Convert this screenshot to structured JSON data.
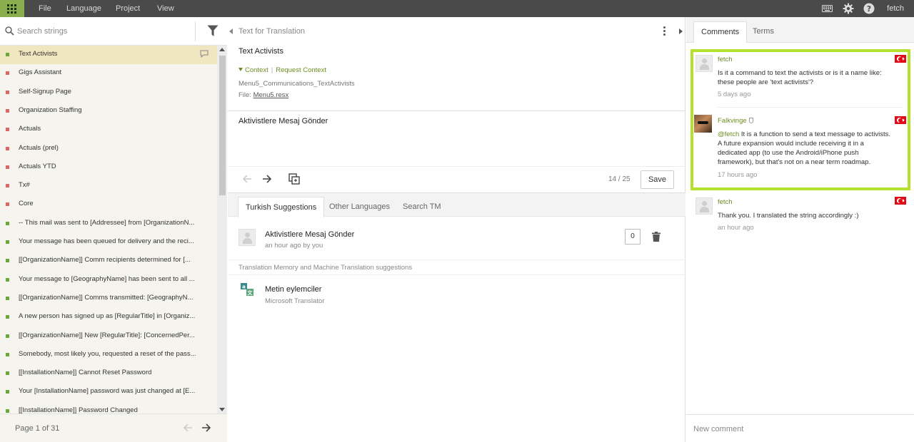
{
  "topbar": {
    "menu": [
      "File",
      "Language",
      "Project",
      "View"
    ],
    "username": "fetch",
    "icons": [
      "apps-grid-icon",
      "keyboard-icon",
      "gear-icon",
      "help-icon"
    ]
  },
  "left": {
    "search_placeholder": "Search strings",
    "strings": [
      {
        "text": "Text Activists",
        "status": "translated",
        "active": true,
        "has_comment": true
      },
      {
        "text": "Gigs Assistant",
        "status": "untranslated"
      },
      {
        "text": "Self-Signup Page",
        "status": "untranslated"
      },
      {
        "text": "Organization Staffing",
        "status": "untranslated"
      },
      {
        "text": "Actuals",
        "status": "untranslated"
      },
      {
        "text": "Actuals (prel)",
        "status": "untranslated"
      },
      {
        "text": "Actuals YTD",
        "status": "untranslated"
      },
      {
        "text": "Tx#",
        "status": "untranslated"
      },
      {
        "text": "Core",
        "status": "untranslated"
      },
      {
        "text": "-- This mail was sent to [Addressee] from [OrganizationN...",
        "status": "translated"
      },
      {
        "text": "Your message has been queued for delivery and the reci...",
        "status": "translated"
      },
      {
        "text": "[[OrganizationName]] Comm recipients determined for [...",
        "status": "translated"
      },
      {
        "text": "Your message to [GeographyName] has been sent to all ...",
        "status": "translated"
      },
      {
        "text": "[[OrganizationName]] Comms transmitted: [GeographyN...",
        "status": "translated"
      },
      {
        "text": "A new person has signed up as [RegularTitle] in [Organiz...",
        "status": "translated"
      },
      {
        "text": "[[OrganizationName]] New [RegularTitle]: [ConcernedPer...",
        "status": "translated"
      },
      {
        "text": "Somebody, most likely you, requested a reset of the pass...",
        "status": "translated"
      },
      {
        "text": "[[InstallationName]] Cannot Reset Password",
        "status": "translated"
      },
      {
        "text": "Your [InstallationName] password was just changed at [E...",
        "status": "translated"
      },
      {
        "text": "[[InstallationName]] Password Changed",
        "status": "translated"
      }
    ],
    "pager_label": "Page 1 of 31"
  },
  "middle": {
    "section_title": "Text for Translation",
    "source_text": "Text Activists",
    "context_label": "Context",
    "request_context_label": "Request Context",
    "string_key": "Menu5_Communications_TextActivists",
    "file_prefix": "File:",
    "file_name": "Menu5.resx",
    "translation_value": "Aktivistlere Mesaj Gönder",
    "counter": "14 / 25",
    "save_label": "Save",
    "tabs": [
      "Turkish Suggestions",
      "Other Languages",
      "Search TM"
    ],
    "suggestion": {
      "text": "Aktivistlere Mesaj Gönder",
      "meta": "an hour ago by you",
      "votes": "0"
    },
    "tm_header": "Translation Memory and Machine Translation suggestions",
    "machine": {
      "text": "Metin eylemciler",
      "source": "Microsoft Translator"
    }
  },
  "right": {
    "tabs": [
      "Comments",
      "Terms"
    ],
    "comments": [
      {
        "author": "fetch",
        "lines": [
          "Is it a command to text the activists or is it a name like:",
          "these people are 'text activists'?"
        ],
        "time": "5 days ago"
      },
      {
        "author": "Falkvinge",
        "mention": "@fetch",
        "lines": [
          "It is a function to send a text message to activists.",
          "A future expansion would include receiving it in a",
          "dedicated app (to use the Android/iPhone push",
          "framework), but that's not on a near term roadmap."
        ],
        "time": "17 hours ago"
      },
      {
        "author": "fetch",
        "lines": [
          "Thank you. I translated the string accordingly :)"
        ],
        "time": "an hour ago"
      }
    ],
    "new_comment_placeholder": "New comment"
  },
  "colors": {
    "accent_green": "#6f8d22",
    "highlight_border": "#b6e02e",
    "status_translated": "#6aa83a",
    "status_untranslated": "#e06666",
    "active_row": "#f0e6c0",
    "topbar": "#4a4a4a"
  }
}
